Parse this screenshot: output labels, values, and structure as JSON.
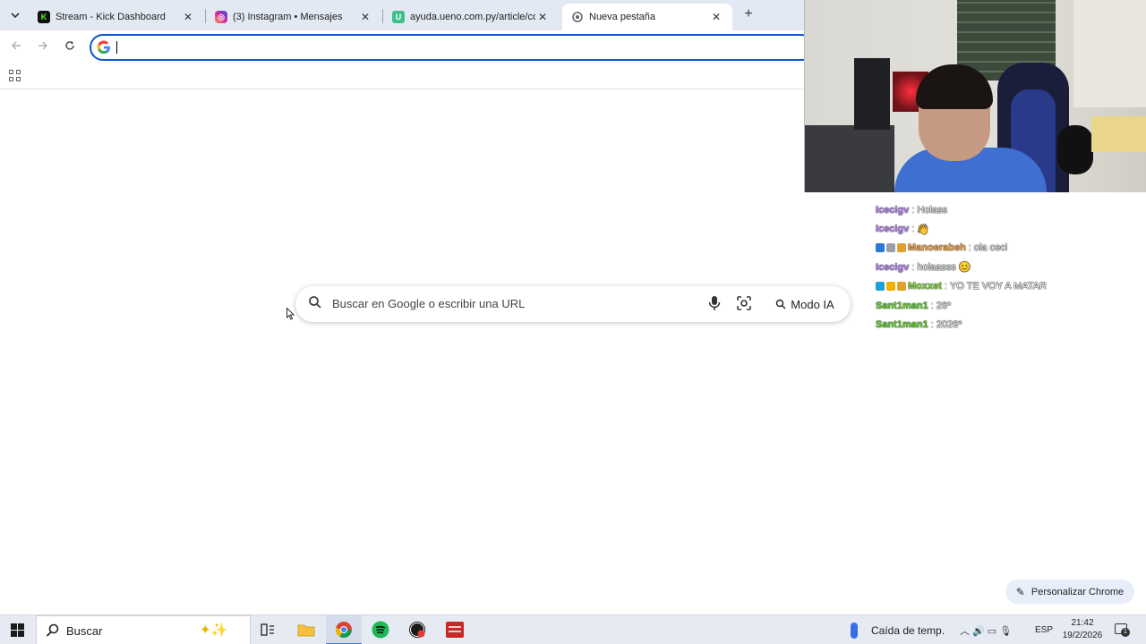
{
  "browser": {
    "tabs": [
      {
        "title": "Stream - Kick Dashboard",
        "favicon": "kick-icon",
        "favicon_color": "#53fc18",
        "active": false
      },
      {
        "title": "(3) Instagram • Mensajes",
        "favicon": "instagram-icon",
        "favicon_color": "#d6249f",
        "active": false
      },
      {
        "title": "ayuda.ueno.com.py/article/com",
        "favicon": "ueno-icon",
        "favicon_color": "#3ec08a",
        "active": false
      },
      {
        "title": "Nueva pestaña",
        "favicon": "chrome-newtab-icon",
        "favicon_color": "#5f6368",
        "active": true
      }
    ],
    "new_tab_symbol": "+",
    "tab_close_symbol": "✕",
    "omnibox_value": ""
  },
  "ntp": {
    "search_placeholder": "Buscar en Google o escribir una URL",
    "ai_mode_label": "Modo IA",
    "customize_label": "Personalizar Chrome"
  },
  "chat": [
    {
      "badges": [],
      "user": "Icecigv",
      "user_color": "#b783f2",
      "message": "Holass"
    },
    {
      "badges": [],
      "user": "Icecigv",
      "user_color": "#b783f2",
      "message": "👋"
    },
    {
      "badges": [
        "#2a78d8",
        "#9aa0a8",
        "#e0a030"
      ],
      "user": "Manoerabeh",
      "user_color": "#f0a040",
      "message": "ola ceci"
    },
    {
      "badges": [],
      "user": "Icecigv",
      "user_color": "#b783f2",
      "message": "holaasss 😊"
    },
    {
      "badges": [
        "#1fa0d8",
        "#f0b000",
        "#e0a030"
      ],
      "user": "Moxxet",
      "user_color": "#7ed63a",
      "message": "YO TE VOY A MATAR"
    },
    {
      "badges": [],
      "user": "Sant1man1",
      "user_color": "#5fd02a",
      "message": "26*"
    },
    {
      "badges": [],
      "user": "Sant1man1",
      "user_color": "#5fd02a",
      "message": "2026*"
    }
  ],
  "taskbar": {
    "search_label": "Buscar",
    "weather_text": "Caída de temp.",
    "language": "ESP",
    "time": "21:42",
    "date": "19/2/2026",
    "notification_count": "1"
  }
}
